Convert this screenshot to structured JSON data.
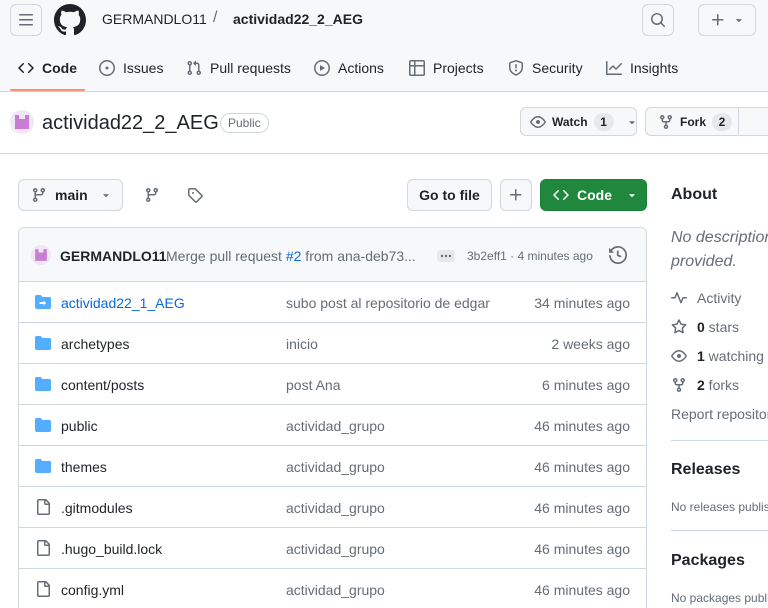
{
  "header": {
    "owner": "GERMANDLO11",
    "separator": "/",
    "repo": "actividad22_2_AEG",
    "tabs": [
      {
        "label": "Code",
        "icon": "code-icon",
        "active": true
      },
      {
        "label": "Issues",
        "icon": "issue-icon"
      },
      {
        "label": "Pull requests",
        "icon": "pull-request-icon"
      },
      {
        "label": "Actions",
        "icon": "play-icon"
      },
      {
        "label": "Projects",
        "icon": "table-icon"
      },
      {
        "label": "Security",
        "icon": "shield-icon"
      },
      {
        "label": "Insights",
        "icon": "graph-icon"
      }
    ]
  },
  "repo": {
    "name": "actividad22_2_AEG",
    "visibility": "Public",
    "watch_label": "Watch",
    "watch_count": "1",
    "fork_label": "Fork",
    "fork_count": "2"
  },
  "toolbar": {
    "branch": "main",
    "goto_file": "Go to file",
    "code_label": "Code"
  },
  "commit": {
    "author": "GERMANDLO11",
    "message_prefix": "Merge pull request ",
    "pr_link": "#2",
    "message_suffix": " from ana-deb73...",
    "meta": "3b2eff1 · 4 minutes ago"
  },
  "files": [
    {
      "name": "actividad22_1_AEG",
      "type": "submodule",
      "message": "subo post al repositorio de edgar",
      "date": "34 minutes ago"
    },
    {
      "name": "archetypes",
      "type": "folder",
      "message": "inicio",
      "date": "2 weeks ago"
    },
    {
      "name": "content/posts",
      "type": "folder",
      "message": "post Ana",
      "date": "6 minutes ago"
    },
    {
      "name": "public",
      "type": "folder",
      "message": "actividad_grupo",
      "date": "46 minutes ago"
    },
    {
      "name": "themes",
      "type": "folder",
      "message": "actividad_grupo",
      "date": "46 minutes ago"
    },
    {
      "name": ".gitmodules",
      "type": "file",
      "message": "actividad_grupo",
      "date": "46 minutes ago"
    },
    {
      "name": ".hugo_build.lock",
      "type": "file",
      "message": "actividad_grupo",
      "date": "46 minutes ago"
    },
    {
      "name": "config.yml",
      "type": "file",
      "message": "actividad_grupo",
      "date": "46 minutes ago"
    }
  ],
  "sidebar": {
    "about_title": "About",
    "description_line1": "No description,",
    "description_line2": "provided.",
    "activity": "Activity",
    "stars_count": "0",
    "stars_label": " stars",
    "watching_count": "1",
    "watching_label": " watching",
    "forks_count": "2",
    "forks_label": " forks",
    "report": "Report repository",
    "releases_title": "Releases",
    "releases_text": "No releases published",
    "packages_title": "Packages",
    "packages_text": "No packages published"
  },
  "colors": {
    "accent_green": "#1f883d",
    "link_blue": "#0969da",
    "folder_blue": "#54aeff",
    "tab_underline": "#fd8c73"
  }
}
